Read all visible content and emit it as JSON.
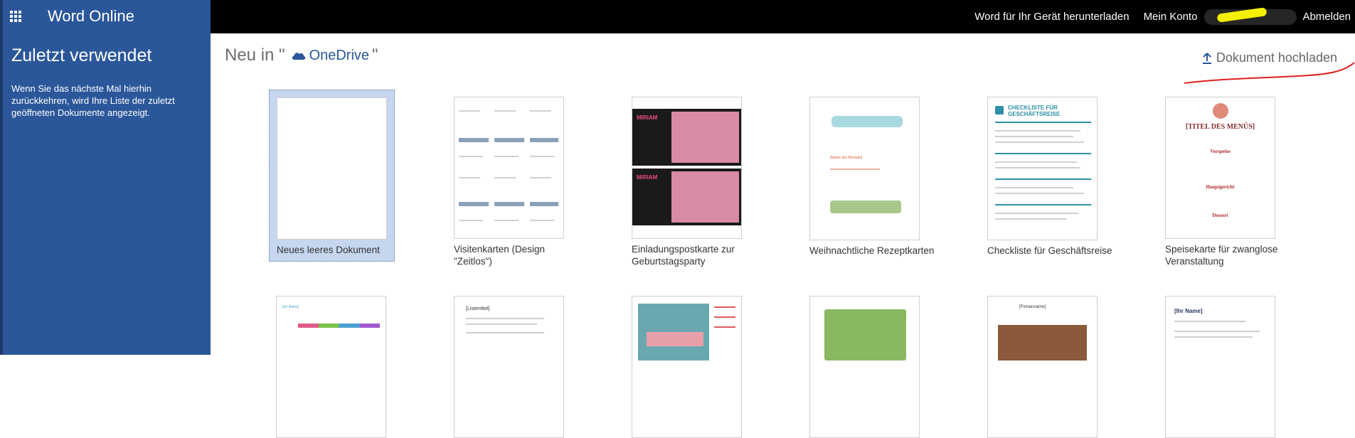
{
  "app": {
    "title": "Word Online"
  },
  "topbar": {
    "download_label": "Word für Ihr Gerät herunterladen",
    "account_label": "Mein Konto",
    "signout_label": "Abmelden"
  },
  "sidebar": {
    "heading": "Zuletzt verwendet",
    "text": "Wenn Sie das nächste Mal hierhin zurückkehren, wird Ihre Liste der zuletzt geöffneten Dokumente angezeigt."
  },
  "main": {
    "header_prefix": "Neu in \"",
    "onedrive_label": "OneDrive",
    "header_suffix": "\"",
    "upload_label": "Dokument hochladen",
    "templates": [
      {
        "label": "Neues leeres Dokument"
      },
      {
        "label": "Visitenkarten (Design \"Zeitlos\")"
      },
      {
        "label": "Einladungspostkarte zur Geburtstagsparty"
      },
      {
        "label": "Weihnachtliche Rezeptkarten"
      },
      {
        "label": "Checkliste für Geschäftsreise"
      },
      {
        "label": "Speisekarte für zwanglose Veranstaltung"
      }
    ]
  },
  "thumbs": {
    "invite_name": "MIRIAM",
    "checklist_title": "CHECKLISTE FÜR GESCHÄFTSREISE",
    "menu_title": "[TITEL DES MENÜS]",
    "menu_sections": [
      "Vorspeise",
      "Hauptgericht",
      "Dessert"
    ],
    "recipe_name": "[Name des Rezepts]",
    "list_title": "[Listentitel]",
    "vorname": "[Firmenname]",
    "ihr_name": "[Ihr Name]"
  },
  "colors": {
    "sidebar": "#2b579a",
    "topbar": "#000000",
    "accent": "#2b579a"
  }
}
